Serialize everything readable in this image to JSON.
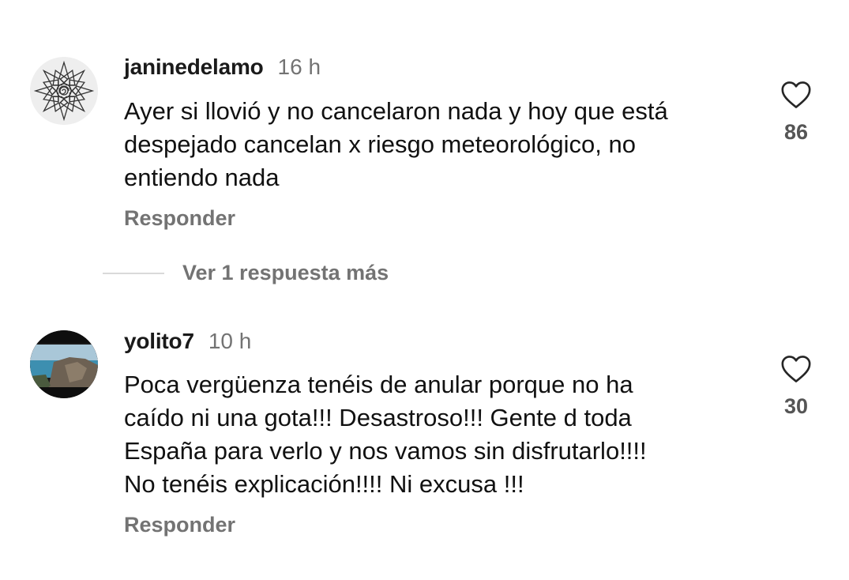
{
  "comments": [
    {
      "username": "janinedelamo",
      "time": "16 h",
      "text_lines": [
        "Ayer si llovió y no cancelaron nada y hoy que está",
        "despejado cancelan x riesgo meteorológico, no",
        "entiendo nada"
      ],
      "likes": "86",
      "reply_label": "Responder",
      "avatar_icon": "mandala-drawing-avatar",
      "view_replies_label": "Ver 1 respuesta más"
    },
    {
      "username": "yolito7",
      "time": "10 h",
      "text_lines": [
        "Poca vergüenza tenéis de anular porque no ha",
        "caído ni una gota!!! Desastroso!!! Gente d toda",
        "España para verlo y nos vamos sin disfrutarlo!!!!",
        "No tenéis explicación!!!! Ni excusa !!!"
      ],
      "likes": "30",
      "reply_label": "Responder",
      "avatar_icon": "sea-cliff-photo-avatar"
    }
  ],
  "icons": {
    "like": "heart-outline-icon"
  },
  "colors": {
    "text": "#111111",
    "secondary": "#737373",
    "like_count": "#555555",
    "divider": "#d9d9d9",
    "background": "#ffffff"
  }
}
